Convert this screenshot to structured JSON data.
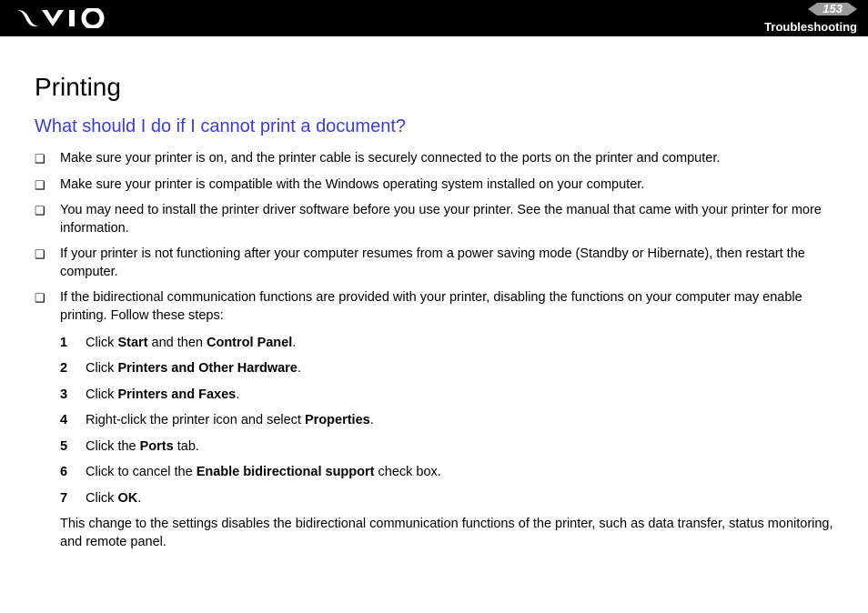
{
  "header": {
    "page_number": "153",
    "section": "Troubleshooting"
  },
  "title": "Printing",
  "subtitle": "What should I do if I cannot print a document?",
  "bullets": [
    "Make sure your printer is on, and the printer cable is securely connected to the ports on the printer and computer.",
    "Make sure your printer is compatible with the Windows operating system installed on your computer.",
    "You may need to install the printer driver software before you use your printer. See the manual that came with your printer for more information.",
    "If your printer is not functioning after your computer resumes from a power saving mode (Standby or Hibernate), then restart the computer.",
    "If the bidirectional communication functions are provided with your printer, disabling the functions on your computer may enable printing. Follow these steps:"
  ],
  "steps": [
    {
      "n": "1",
      "pre": "Click ",
      "b1": "Start",
      "mid": " and then ",
      "b2": "Control Panel",
      "post": "."
    },
    {
      "n": "2",
      "pre": "Click ",
      "b1": "Printers and Other Hardware",
      "mid": "",
      "b2": "",
      "post": "."
    },
    {
      "n": "3",
      "pre": "Click ",
      "b1": "Printers and Faxes",
      "mid": "",
      "b2": "",
      "post": "."
    },
    {
      "n": "4",
      "pre": "Right-click the printer icon and select ",
      "b1": "Properties",
      "mid": "",
      "b2": "",
      "post": "."
    },
    {
      "n": "5",
      "pre": "Click the ",
      "b1": "Ports",
      "mid": "",
      "b2": "",
      "post": " tab."
    },
    {
      "n": "6",
      "pre": "Click to cancel the ",
      "b1": "Enable bidirectional support",
      "mid": "",
      "b2": "",
      "post": " check box."
    },
    {
      "n": "7",
      "pre": "Click ",
      "b1": "OK",
      "mid": "",
      "b2": "",
      "post": "."
    }
  ],
  "note": "This change to the settings disables the bidirectional communication functions of the printer, such as data transfer, status monitoring, and remote panel."
}
